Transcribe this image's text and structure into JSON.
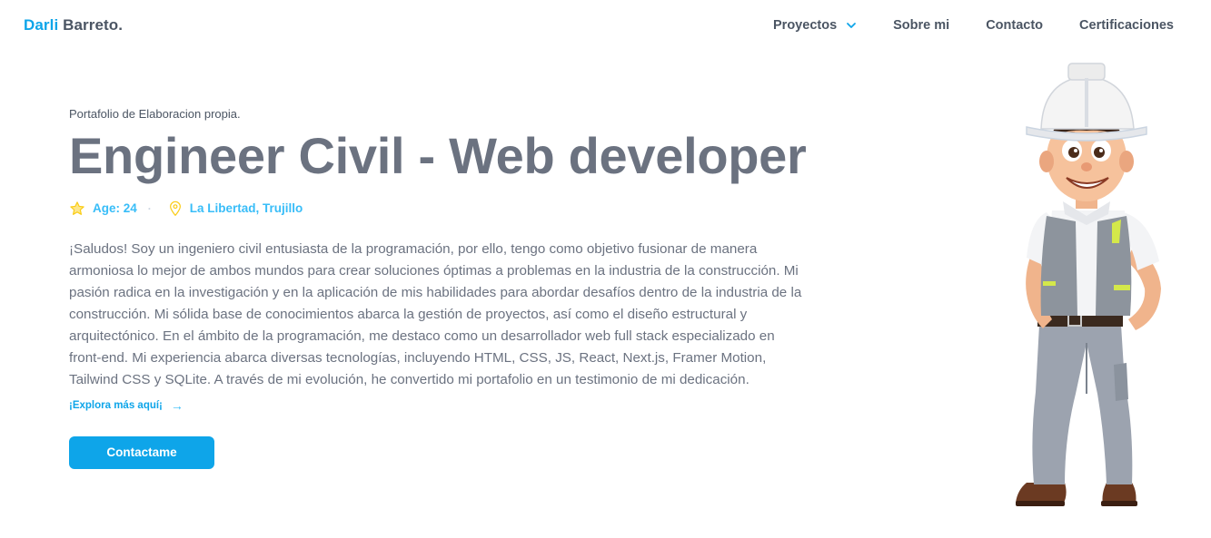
{
  "nav": {
    "logo_first": "Darli",
    "logo_last": "Barreto.",
    "items": [
      {
        "label": "Proyectos",
        "has_dropdown": true
      },
      {
        "label": "Sobre mi"
      },
      {
        "label": "Contacto"
      },
      {
        "label": "Certificaciones"
      }
    ]
  },
  "hero": {
    "kicker": "Portafolio de Elaboracion propia.",
    "title": "Engineer Civil - Web developer",
    "age": "Age: 24",
    "location": "La Libertad, Trujillo",
    "bio": "¡Saludos! Soy un ingeniero civil entusiasta de la programación, por ello, tengo como objetivo fusionar de manera armoniosa lo mejor de ambos mundos para crear soluciones óptimas a problemas en la industria de la construcción. Mi pasión radica en la investigación y en la aplicación de mis habilidades para abordar desafíos dentro de la industria de la construcción. Mi sólida base de conocimientos abarca la gestión de proyectos, así como el diseño estructural y arquitectónico. En el ámbito de la programación, me destaco como un desarrollador web full stack especializado en front-end. Mi experiencia abarca diversas tecnologías, incluyendo HTML, CSS, JS, React, Next.js, Framer Motion, Tailwind CSS y SQLite. A través de mi evolución, he convertido mi portafolio en un testimonio de mi dedicación.",
    "explore_label": "¡Explora más aquí¡",
    "cta_label": "Contactame"
  },
  "icons": {
    "age": "star-icon",
    "location": "map-pin-icon",
    "explore": "arrow-right-icon",
    "dropdown": "chevron-down-icon"
  },
  "colors": {
    "accent": "#0ea5e9",
    "accent_light": "#38bdf8",
    "star": "#facc15",
    "text": "#4b5563",
    "title": "#6b7280"
  }
}
